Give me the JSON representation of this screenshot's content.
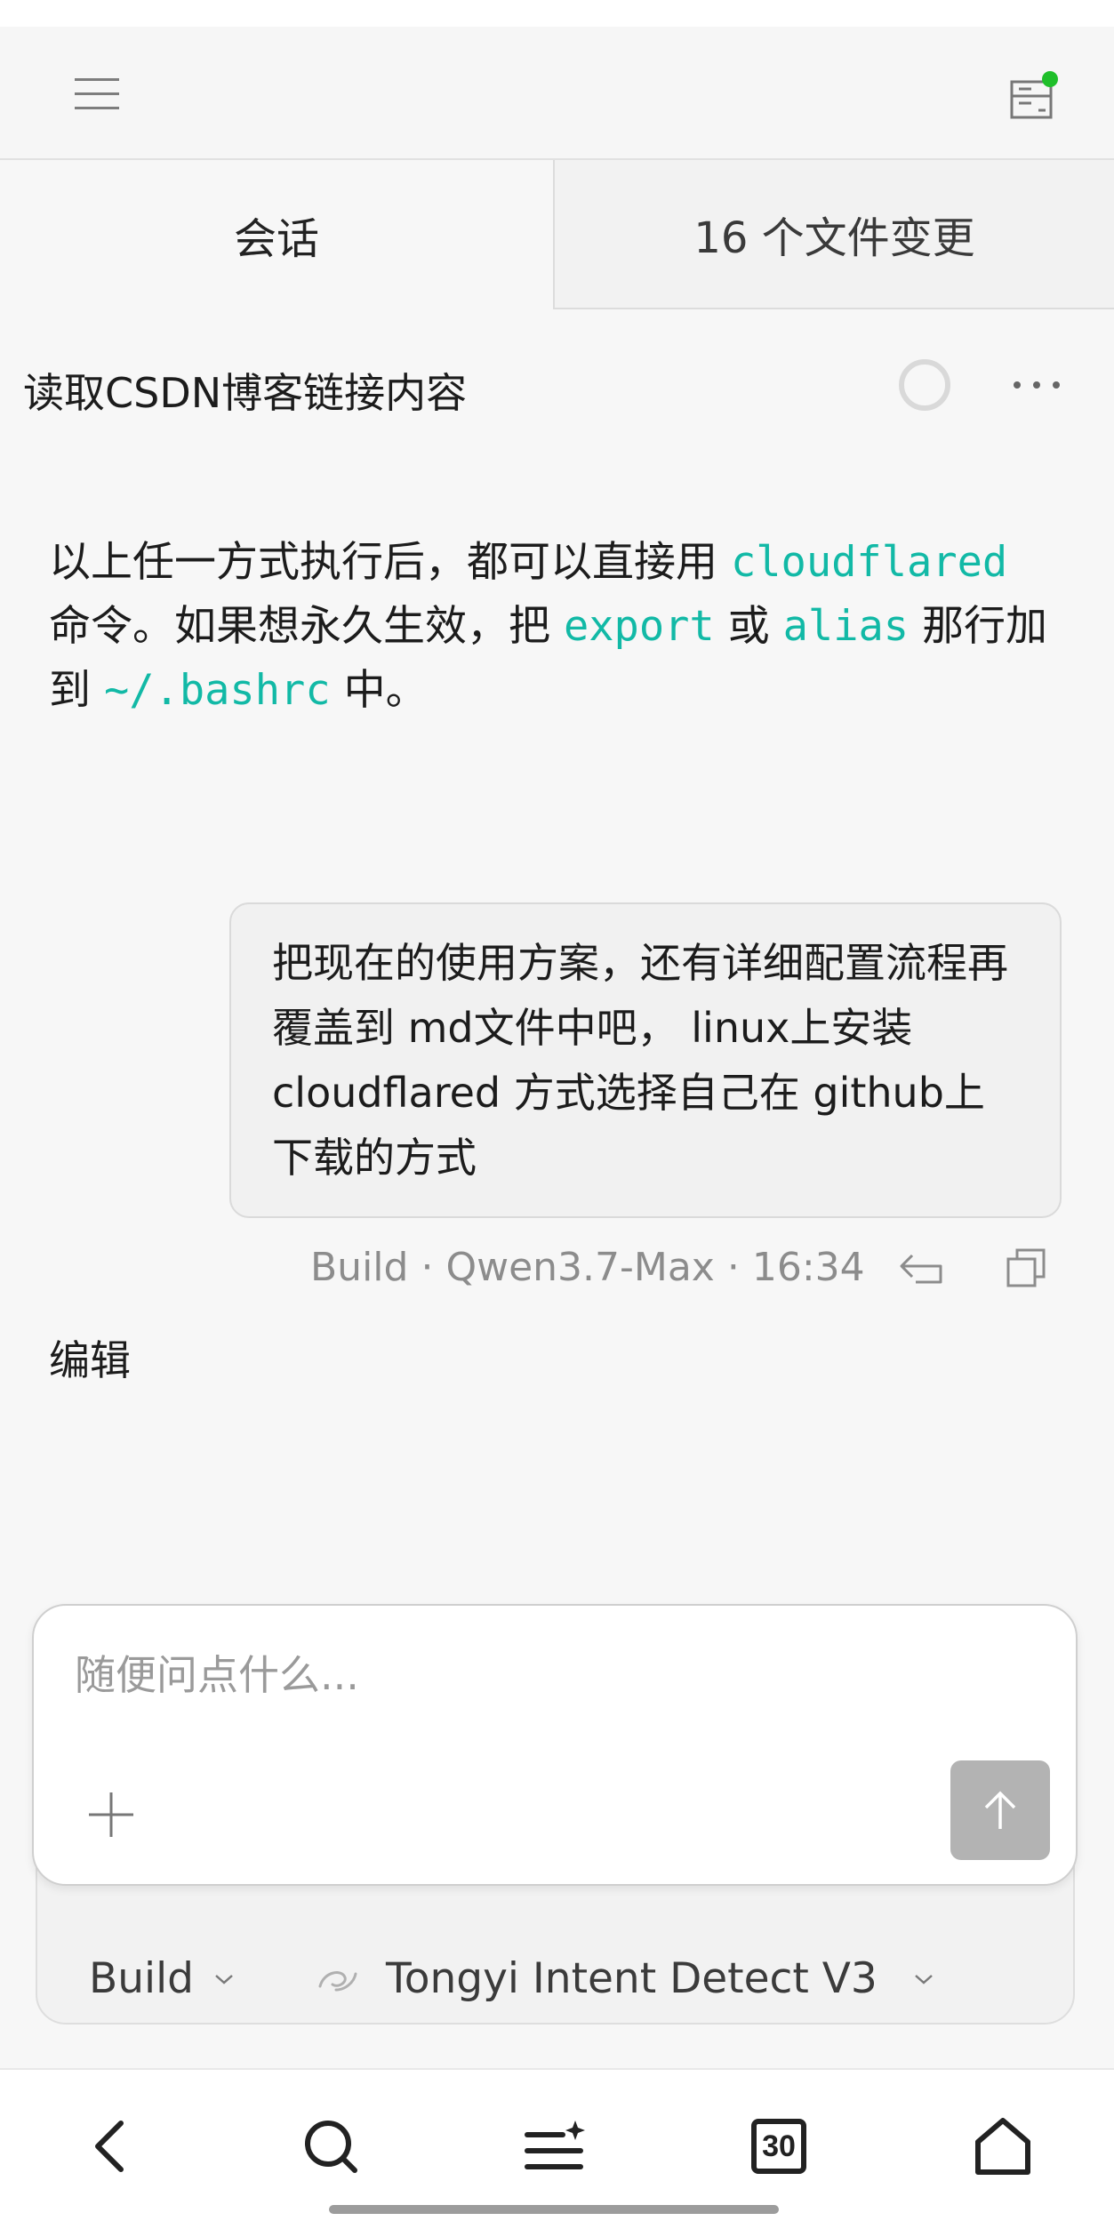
{
  "header": {
    "menu_icon": "hamburger-menu-icon",
    "files_icon": "file-tree-icon",
    "notification_color": "#1fbf2a"
  },
  "tabs": [
    {
      "label": "会话"
    },
    {
      "label": "16 个文件变更"
    }
  ],
  "session": {
    "title": "读取CSDN博客链接内容",
    "status_icon": "loading-spinner-icon",
    "more_icon": "more-horizontal-icon"
  },
  "assistant_message": {
    "part1": "以上任一方式执行后，都可以直接用 ",
    "code1": "cloudflared",
    "part2": "命令。如果想永久生效，把 ",
    "code2": "export",
    "part3": " 或 ",
    "code3": "alias",
    "part4": " 那行加到 ",
    "code4": "~/.bashrc",
    "part5": " 中。"
  },
  "user_message": {
    "text": "把现在的使用方案，还有详细配置流程再覆盖到 md文件中吧， linux上安装 cloudflared 方式选择自己在 github上下载的方式",
    "meta": {
      "agent": "Build",
      "model": "Qwen3.7-Max",
      "time": "16:34",
      "separator": "·"
    }
  },
  "edit_label": "编辑",
  "composer": {
    "placeholder": "随便问点什么...",
    "value": ""
  },
  "options": {
    "agent": "Build",
    "model": "Tongyi Intent Detect V3"
  },
  "bottom_nav": {
    "calendar_day": "30"
  },
  "colors": {
    "code": "#12b9a6",
    "send_button": "#b3b3b3"
  }
}
